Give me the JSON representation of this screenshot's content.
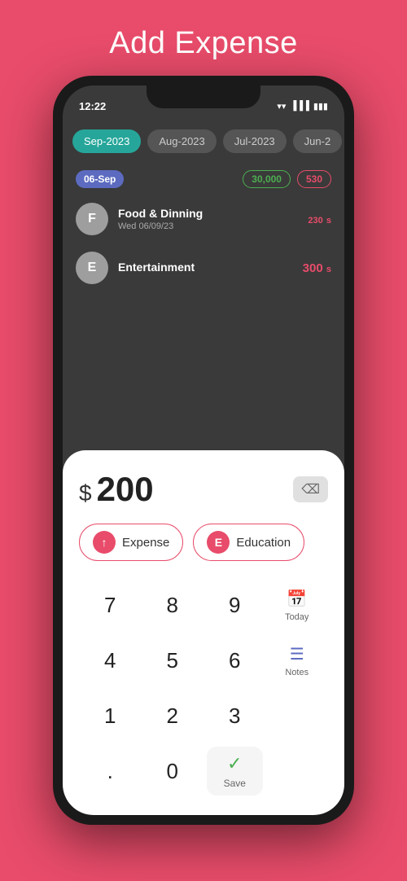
{
  "page": {
    "title": "Add Expense",
    "background_color": "#E84C6A"
  },
  "status_bar": {
    "time": "12:22",
    "icons": [
      "wifi",
      "signal",
      "battery"
    ]
  },
  "month_tabs": [
    {
      "label": "Sep-2023",
      "active": true
    },
    {
      "label": "Aug-2023",
      "active": false
    },
    {
      "label": "Jul-2023",
      "active": false
    },
    {
      "label": "Jun-2",
      "active": false
    }
  ],
  "date_section": {
    "date": "06-Sep",
    "total_income": "30,000",
    "total_expense": "530"
  },
  "transactions": [
    {
      "category": "Food & Dinning",
      "date": "Wed 06/09/23",
      "amount": "230",
      "currency": "s",
      "avatar_letter": "F",
      "avatar_color": "#9E9E9E"
    },
    {
      "category": "Entertainment",
      "date": "",
      "amount": "300",
      "currency": "s",
      "avatar_letter": "E",
      "avatar_color": "#9E9E9E"
    }
  ],
  "modal": {
    "currency_symbol": "$",
    "amount": "200",
    "backspace_label": "⌫",
    "expense_btn_label": "Expense",
    "expense_btn_icon": "↑",
    "category_btn_label": "Education",
    "category_btn_icon": "E",
    "keypad": {
      "keys": [
        "7",
        "8",
        "9",
        "4",
        "5",
        "6",
        "1",
        "2",
        "3",
        ".",
        "0"
      ],
      "today_label": "Today",
      "notes_label": "Notes",
      "save_label": "Save"
    }
  }
}
